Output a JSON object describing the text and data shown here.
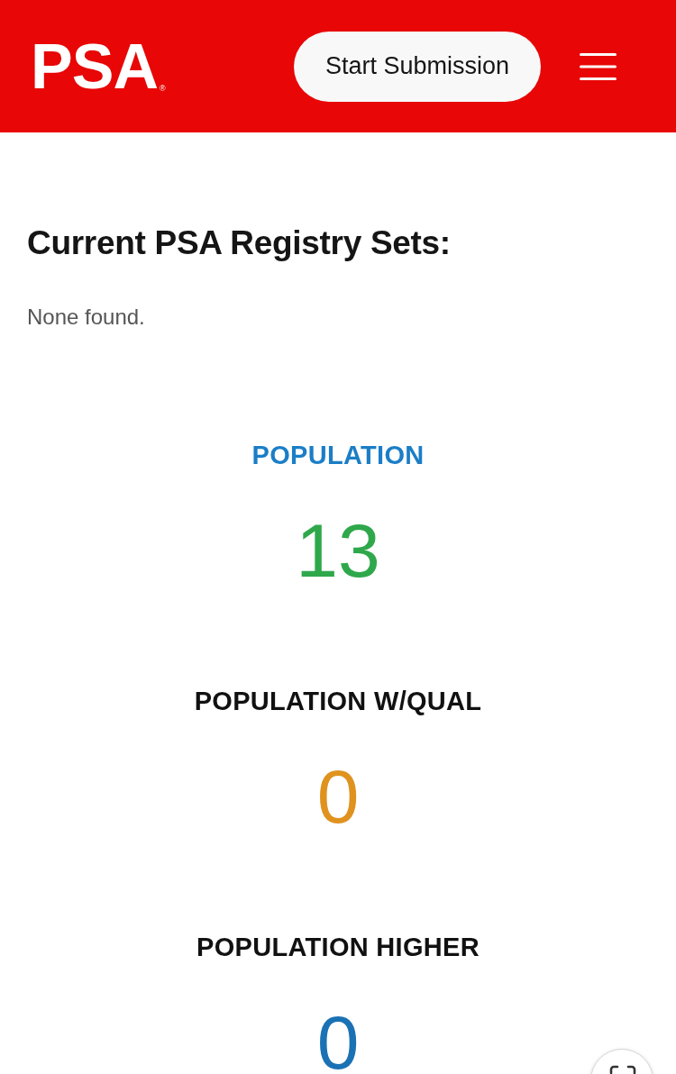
{
  "header": {
    "logo": "PSA",
    "logo_mark": "®",
    "button": "Start Submission",
    "menu": {
      "kind": "hamburger"
    }
  },
  "registry": {
    "title": "Current PSA Registry Sets:",
    "empty_text": "None found."
  },
  "stats": [
    {
      "label": "POPULATION",
      "link": true,
      "value": "13",
      "color": "#2fa84b"
    },
    {
      "label": "POPULATION W/QUAL",
      "link": false,
      "value": "0",
      "color": "#e0921f"
    },
    {
      "label": "POPULATION HIGHER",
      "link": false,
      "value": "0",
      "color": "#1a72b4"
    }
  ],
  "floating_button": {
    "kind": "scan"
  }
}
